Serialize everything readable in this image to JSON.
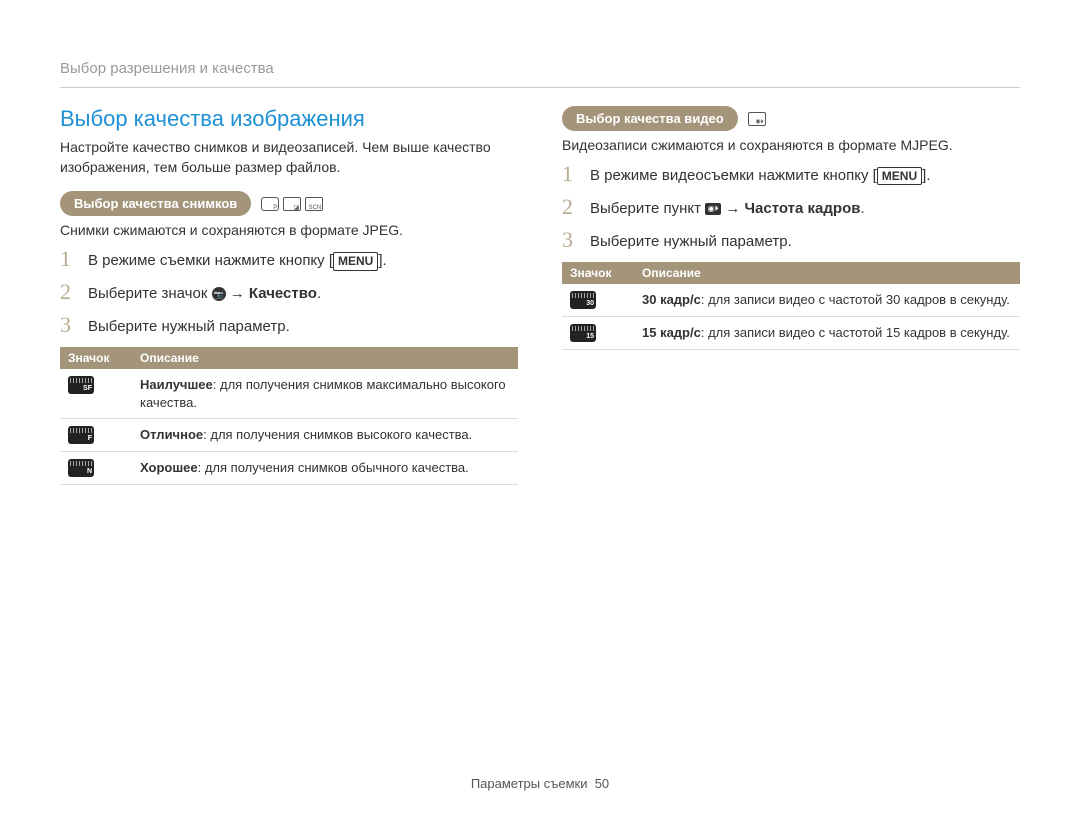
{
  "breadcrumb": "Выбор разрешения и качества",
  "left": {
    "title": "Выбор качества изображения",
    "intro": "Настройте качество снимков и видеозаписей. Чем выше качество изображения, тем больше размер файлов.",
    "pill": "Выбор качества снимков",
    "note": "Снимки сжимаются и сохраняются в формате JPEG.",
    "steps": {
      "s1_a": "В режиме съемки нажмите кнопку ",
      "s1_menu": "MENU",
      "s1_b": ".",
      "s2_a": "Выберите значок ",
      "s2_arrow": " → ",
      "s2_b": "Качество",
      "s2_c": ".",
      "s3": "Выберите нужный параметр."
    },
    "table": {
      "h1": "Значок",
      "h2": "Описание",
      "rows": [
        {
          "lead": "Наилучшее",
          "tail": ": для получения снимков максимально высокого качества."
        },
        {
          "lead": "Отличное",
          "tail": ": для получения снимков высокого качества."
        },
        {
          "lead": "Хорошее",
          "tail": ": для получения снимков обычного качества."
        }
      ]
    }
  },
  "right": {
    "pill": "Выбор качества видео",
    "note": "Видеозаписи сжимаются и сохраняются в формате MJPEG.",
    "steps": {
      "s1_a": "В режиме видеосъемки нажмите кнопку ",
      "s1_menu": "MENU",
      "s1_b": ".",
      "s2_a": "Выберите пункт ",
      "s2_arrow": " → ",
      "s2_b": "Частота кадров",
      "s2_c": ".",
      "s3": "Выберите нужный параметр."
    },
    "table": {
      "h1": "Значок",
      "h2": "Описание",
      "rows": [
        {
          "lead": "30 кадр/с",
          "tail": ": для записи видео с частотой 30 кадров в секунду."
        },
        {
          "lead": "15 кадр/с",
          "tail": ": для записи видео с частотой 15 кадров в секунду."
        }
      ]
    }
  },
  "footer": {
    "label": "Параметры съемки",
    "page": "50"
  }
}
